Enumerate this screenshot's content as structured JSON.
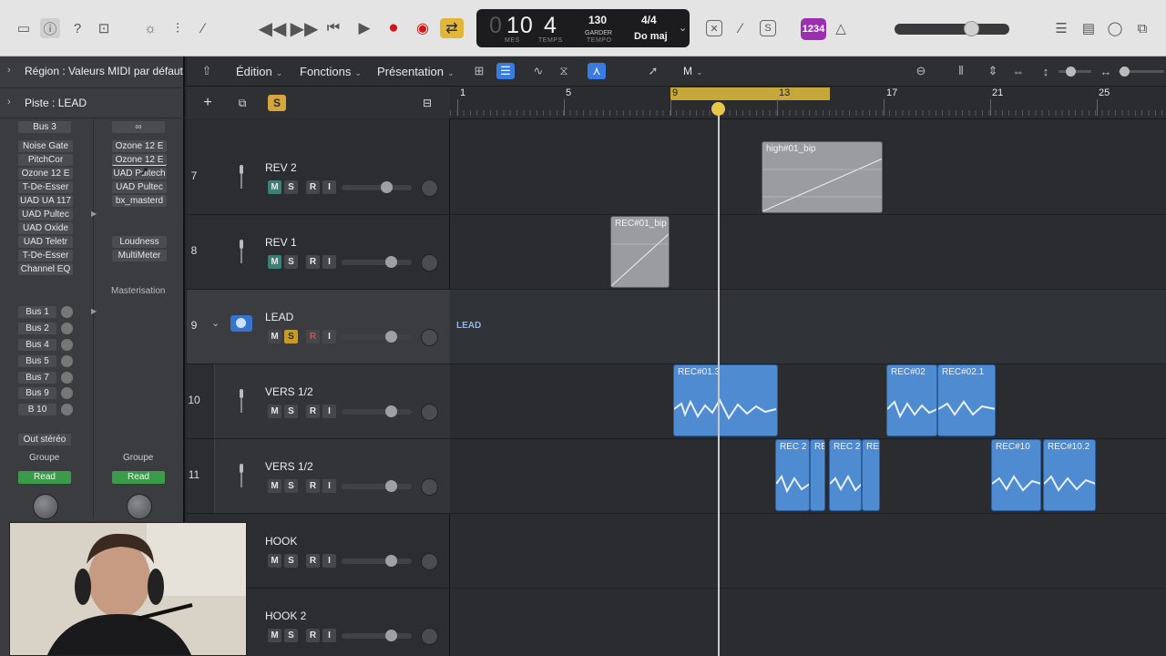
{
  "toolbar": {
    "lcd_bar": "10",
    "lcd_beat": "4",
    "lcd_bar_label": "MES",
    "lcd_beat_label": "TEMPS",
    "tempo": "130",
    "tempo_sub": "GARDER",
    "tempo_label": "TEMPO",
    "signature": "4/4",
    "key": "Do maj",
    "badge": "1234",
    "master_volume": 0.7
  },
  "menubar": {
    "edition": "Édition",
    "fonctions": "Fonctions",
    "presentation": "Présentation",
    "mode_m": "M"
  },
  "inspector": {
    "region_prefix": "Région :",
    "region_value": "Valeurs MIDI par défaut",
    "track_prefix": "Piste :",
    "track_value": "LEAD",
    "bus_top": "Bus 3",
    "inserts_left": [
      "Noise Gate",
      "PitchCor",
      "Ozone 12 E",
      "T-De-Esser",
      "UAD UA 117",
      "UAD Pultec",
      "UAD Oxide",
      "UAD Teletr",
      "T-De-Esser",
      "Channel EQ"
    ],
    "inserts_right": [
      "Ozone 12 E",
      "Ozone 12 E",
      "UAD Pultech",
      "UAD Pultec",
      "bx_masterd",
      "",
      "",
      "Loudness",
      "MultiMeter"
    ],
    "right_label": "Masterisation",
    "sends": [
      "Bus 1",
      "Bus 2",
      "Bus 4",
      "Bus 5",
      "Bus 7",
      "Bus 9",
      "B 10"
    ],
    "output": "Out stéréo",
    "group_label": "Groupe",
    "read_label": "Read"
  },
  "tracks": [
    {
      "num": "7",
      "name": "REV 2",
      "vol": 0.62
    },
    {
      "num": "8",
      "name": "REV 1",
      "vol": 0.71
    },
    {
      "num": "9",
      "name": "LEAD",
      "vol": 0.71
    },
    {
      "num": "10",
      "name": "VERS 1/2",
      "vol": 0.71
    },
    {
      "num": "11",
      "name": "VERS 1/2",
      "vol": 0.71
    },
    {
      "num": "",
      "name": "HOOK",
      "vol": 0.71
    },
    {
      "num": "",
      "name": "HOOK 2",
      "vol": 0.71
    }
  ],
  "track_buttons": {
    "m": "M",
    "s": "S",
    "r": "R",
    "i": "I"
  },
  "ruler": {
    "bars": [
      "1",
      "5",
      "9",
      "13",
      "17",
      "21",
      "25"
    ]
  },
  "regions": {
    "high_bip": "high#01_bip",
    "rec_bip": "REC#01_bip",
    "lead_label": "LEAD",
    "rec013": "REC#01.3",
    "rec02": "REC#02",
    "rec021": "REC#02.1",
    "rec2a": "REC 2",
    "re_a": "RE",
    "rec2b": "REC 2",
    "re_b": "RE",
    "rec10": "REC#10",
    "rec102": "REC#10.2"
  }
}
